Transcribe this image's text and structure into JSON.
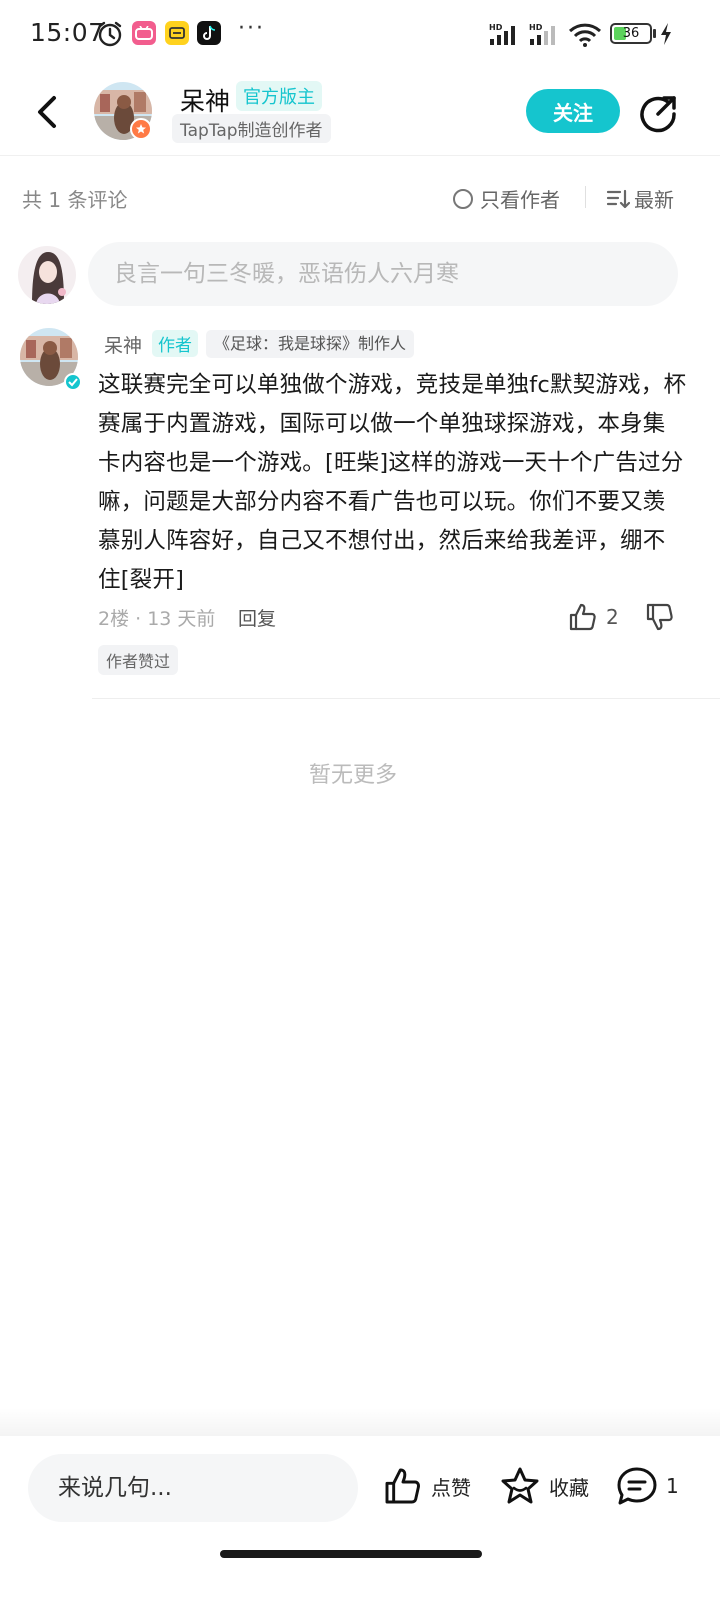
{
  "status_bar": {
    "time": "15:07",
    "more": "···",
    "battery_level": "36",
    "battery_percent": 36,
    "icons": [
      "alarm-icon",
      "bilibili-app-icon",
      "dianping-app-icon",
      "tiktok-app-icon",
      "signal-hd-icon",
      "signal-hd-icon",
      "wifi-icon",
      "battery-icon",
      "charging-icon"
    ]
  },
  "header": {
    "author_name": "呆神",
    "role_tag": "官方版主",
    "subtitle": "TapTap制造创作者",
    "follow_label": "关注",
    "icons": [
      "back-arrow-icon",
      "share-icon"
    ]
  },
  "toolbar": {
    "count_label": "共 1 条评论",
    "author_only_label": "只看作者",
    "sort_label": "最新"
  },
  "comment_input": {
    "placeholder": "良言一句三冬暖，恶语伤人六月寒"
  },
  "comment": {
    "name": "呆神",
    "author_tag": "作者",
    "maker_tag": "《足球：我是球探》制作人",
    "body": "这联赛完全可以单独做个游戏，竞技是单独fc默契游戏，杯赛属于内置游戏，国际可以做一个单独球探游戏，本身集卡内容也是一个游戏。[旺柴]这样的游戏一天十个广告过分嘛，问题是大部分内容不看广告也可以玩。你们不要又羡慕别人阵容好，自己又不想付出，然后来给我差评，绷不住[裂开]",
    "meta": "2楼 · 13 天前",
    "reply_label": "回复",
    "like_count": "2",
    "liked_by_author": "作者赞过"
  },
  "list_end": "暂无更多",
  "bottom_bar": {
    "input_placeholder": "来说几句...",
    "like_label": "点赞",
    "collect_label": "收藏",
    "comment_count": "1"
  },
  "colors": {
    "accent": "#15c5ce",
    "accent_bg": "#e3f8f5",
    "badge_orange": "#ff7a45"
  }
}
